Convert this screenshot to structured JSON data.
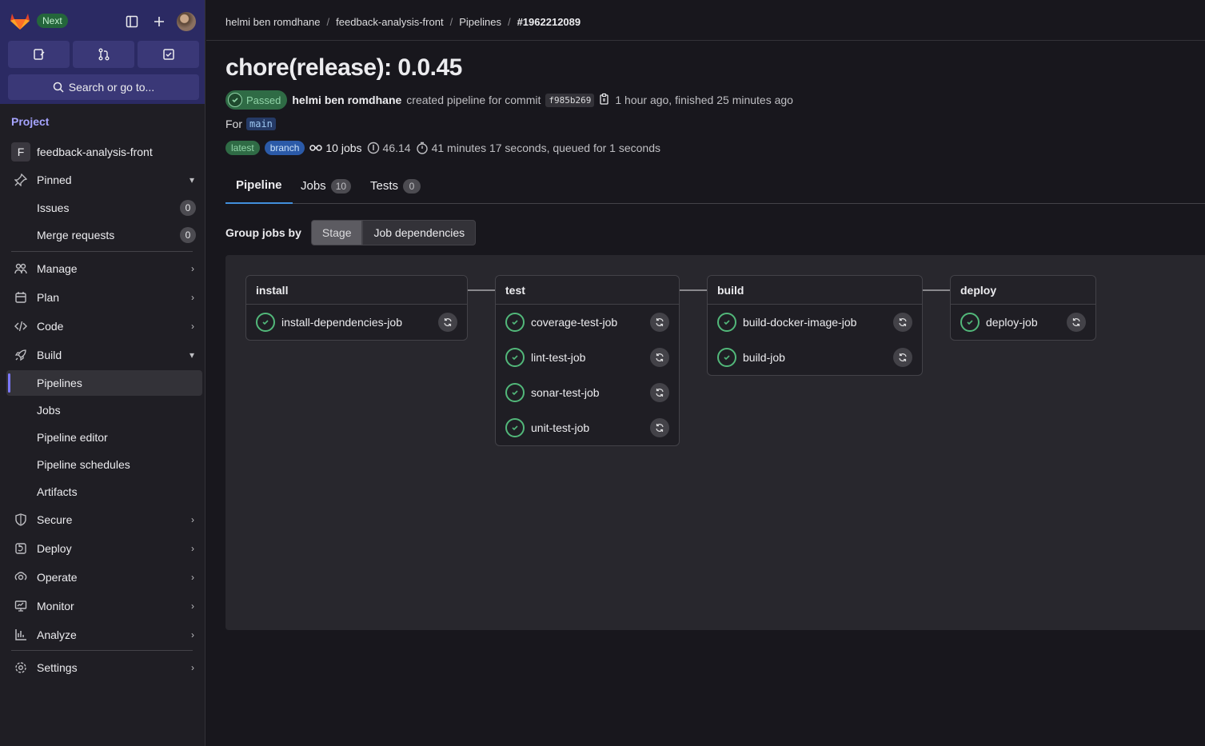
{
  "sidebar": {
    "next_badge": "Next",
    "search_label": "Search or go to...",
    "section_title": "Project",
    "project": {
      "initial": "F",
      "name": "feedback-analysis-front"
    },
    "items": [
      {
        "label": "Pinned",
        "chev": "▾"
      },
      {
        "label": "Issues",
        "count": "0"
      },
      {
        "label": "Merge requests",
        "count": "0"
      },
      {
        "label": "Manage",
        "chev": "›"
      },
      {
        "label": "Plan",
        "chev": "›"
      },
      {
        "label": "Code",
        "chev": "›"
      },
      {
        "label": "Build",
        "chev": "▾"
      },
      {
        "label": "Pipelines"
      },
      {
        "label": "Jobs"
      },
      {
        "label": "Pipeline editor"
      },
      {
        "label": "Pipeline schedules"
      },
      {
        "label": "Artifacts"
      },
      {
        "label": "Secure",
        "chev": "›"
      },
      {
        "label": "Deploy",
        "chev": "›"
      },
      {
        "label": "Operate",
        "chev": "›"
      },
      {
        "label": "Monitor",
        "chev": "›"
      },
      {
        "label": "Analyze",
        "chev": "›"
      },
      {
        "label": "Settings",
        "chev": "›"
      }
    ]
  },
  "breadcrumb": [
    "helmi ben romdhane",
    "feedback-analysis-front",
    "Pipelines",
    "#1962212089"
  ],
  "pipeline": {
    "title": "chore(release): 0.0.45",
    "status": "Passed",
    "author": "helmi ben romdhane",
    "action_text": "created pipeline for commit",
    "sha": "f985b269",
    "time_text": "1 hour ago, finished 25 minutes ago",
    "for_label": "For",
    "ref": "main",
    "tag_latest": "latest",
    "tag_branch": "branch",
    "jobs_count": "10 jobs",
    "compute": "46.14",
    "duration": "41 minutes 17 seconds, queued for 1 seconds"
  },
  "tabs": [
    {
      "label": "Pipeline"
    },
    {
      "label": "Jobs",
      "count": "10"
    },
    {
      "label": "Tests",
      "count": "0"
    }
  ],
  "groupby": {
    "label": "Group jobs by",
    "stage": "Stage",
    "deps": "Job dependencies"
  },
  "stages": [
    {
      "name": "install",
      "jobs": [
        "install-dependencies-job"
      ]
    },
    {
      "name": "test",
      "jobs": [
        "coverage-test-job",
        "lint-test-job",
        "sonar-test-job",
        "unit-test-job"
      ]
    },
    {
      "name": "build",
      "jobs": [
        "build-docker-image-job",
        "build-job"
      ]
    },
    {
      "name": "deploy",
      "jobs": [
        "deploy-job"
      ]
    }
  ],
  "colors": {
    "success": "#52b87a",
    "link": "#428fdc",
    "brand": "#7b78ff"
  }
}
